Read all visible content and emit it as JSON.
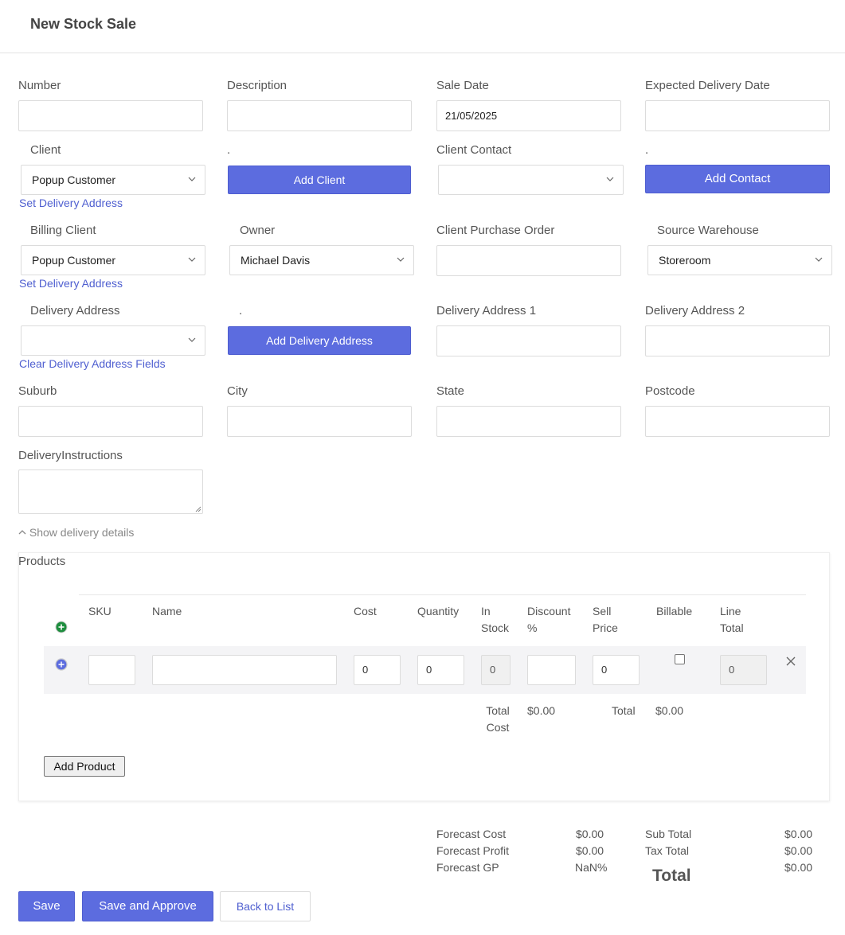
{
  "header": {
    "title": "New Stock Sale"
  },
  "form": {
    "number": {
      "label": "Number",
      "value": ""
    },
    "description": {
      "label": "Description",
      "value": ""
    },
    "sale_date": {
      "label": "Sale Date",
      "value": "21/05/2025"
    },
    "expected_delivery_date": {
      "label": "Expected Delivery Date",
      "value": ""
    },
    "client": {
      "label": "Client",
      "value": "Popup Customer"
    },
    "add_client": {
      "dot": ".",
      "label": "Add Client"
    },
    "client_contact": {
      "label": "Client Contact",
      "value": ""
    },
    "add_contact": {
      "dot": ".",
      "label": "Add Contact"
    },
    "set_delivery_address_1": "Set Delivery Address",
    "billing_client": {
      "label": "Billing Client",
      "value": "Popup Customer"
    },
    "owner": {
      "label": "Owner",
      "value": "Michael Davis"
    },
    "client_purchase_order": {
      "label": "Client Purchase Order",
      "value": ""
    },
    "source_warehouse": {
      "label": "Source Warehouse",
      "value": "Storeroom"
    },
    "set_delivery_address_2": "Set Delivery Address",
    "delivery_address": {
      "label": "Delivery Address",
      "value": ""
    },
    "add_delivery_address": {
      "dot": ".",
      "label": "Add Delivery Address"
    },
    "delivery_address_1": {
      "label": "Delivery Address 1",
      "value": ""
    },
    "delivery_address_2": {
      "label": "Delivery Address 2",
      "value": ""
    },
    "clear_delivery_fields": "Clear Delivery Address Fields",
    "suburb": {
      "label": "Suburb",
      "value": ""
    },
    "city": {
      "label": "City",
      "value": ""
    },
    "state": {
      "label": "State",
      "value": ""
    },
    "postcode": {
      "label": "Postcode",
      "value": ""
    },
    "delivery_instructions": {
      "label": "DeliveryInstructions",
      "value": ""
    },
    "show_delivery_details": "Show delivery details"
  },
  "products": {
    "title": "Products",
    "columns": {
      "sku": "SKU",
      "name": "Name",
      "cost": "Cost",
      "quantity": "Quantity",
      "in_stock_1": "In",
      "in_stock_2": "Stock",
      "discount_1": "Discount",
      "discount_2": "%",
      "sell_price_1": "Sell",
      "sell_price_2": "Price",
      "billable": "Billable",
      "line_total_1": "Line",
      "line_total_2": "Total"
    },
    "row": {
      "sku": "",
      "name": "",
      "cost": "0",
      "quantity": "0",
      "in_stock": "0",
      "discount": "",
      "sell_price": "0",
      "billable": false,
      "line_total": "0"
    },
    "totals": {
      "total_cost_1": "Total",
      "total_cost_2": "Cost",
      "total_cost_value": "$0.00",
      "total_label": "Total",
      "total_value": "$0.00"
    },
    "add_product": "Add Product"
  },
  "summary": {
    "forecast_cost": {
      "label": "Forecast Cost",
      "value": "$0.00"
    },
    "forecast_profit": {
      "label": "Forecast Profit",
      "value": "$0.00"
    },
    "forecast_gp": {
      "label": "Forecast GP",
      "value": "NaN%"
    },
    "sub_total": {
      "label": "Sub Total",
      "value": "$0.00"
    },
    "tax_total": {
      "label": "Tax Total",
      "value": "$0.00"
    },
    "total": {
      "label": "Total",
      "value": "$0.00"
    }
  },
  "actions": {
    "save": "Save",
    "save_and_approve": "Save and Approve",
    "back_to_list": "Back to List"
  },
  "colors": {
    "primary": "#5c6cdf",
    "link": "#4f5fd0",
    "add_row_green": "#1e8e3e"
  },
  "icons": [
    "chevron-down-icon",
    "plus-circle-icon",
    "close-icon",
    "chevron-up-icon"
  ]
}
